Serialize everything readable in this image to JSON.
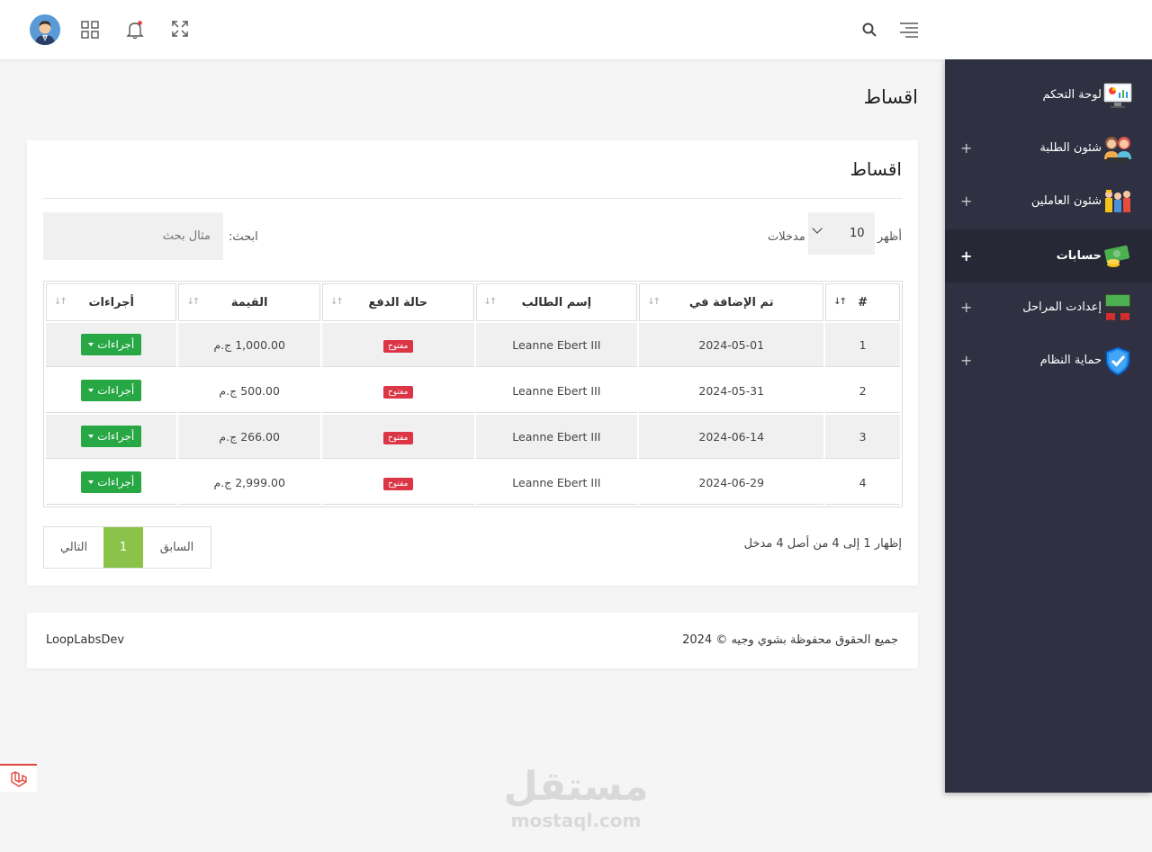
{
  "header": {
    "icons": [
      "menu-icon",
      "search-icon",
      "fullscreen-icon",
      "notification-bell-icon",
      "apps-grid-icon",
      "user-avatar"
    ]
  },
  "sidebar": {
    "items": [
      {
        "label": "لوحة التحكم",
        "icon": "dashboard-icon",
        "expandable": false
      },
      {
        "label": "شئون الطلبة",
        "icon": "students-icon",
        "expandable": true
      },
      {
        "label": "شئون العاملين",
        "icon": "staff-icon",
        "expandable": true
      },
      {
        "label": "حسابات",
        "icon": "money-icon",
        "expandable": true,
        "active": true
      },
      {
        "label": "إعدادت المراحل",
        "icon": "classroom-icon",
        "expandable": true
      },
      {
        "label": "حماية النظام",
        "icon": "shield-icon",
        "expandable": true
      }
    ],
    "plus": "+"
  },
  "page": {
    "title": "اقساط"
  },
  "card": {
    "title": "اقساط",
    "show_label": "أظهر",
    "entries_value": "10",
    "entries_label": "مدخلات",
    "search_label": "ابحث:",
    "search_placeholder": "مثال بحث"
  },
  "table": {
    "columns": [
      "#",
      "تم الإضافة في",
      "إسم الطالب",
      "حالة الدفع",
      "القيمة",
      "أجراءات"
    ],
    "rows": [
      {
        "num": "1",
        "date": "2024-05-01",
        "student": "Leanne Ebert III",
        "status": "مفتوح",
        "amount": "1,000.00 ج.م",
        "action": "أجراءات"
      },
      {
        "num": "2",
        "date": "2024-05-31",
        "student": "Leanne Ebert III",
        "status": "مفتوح",
        "amount": "500.00 ج.م",
        "action": "أجراءات"
      },
      {
        "num": "3",
        "date": "2024-06-14",
        "student": "Leanne Ebert III",
        "status": "مفتوح",
        "amount": "266.00 ج.م",
        "action": "أجراءات"
      },
      {
        "num": "4",
        "date": "2024-06-29",
        "student": "Leanne Ebert III",
        "status": "مفتوح",
        "amount": "2,999.00 ج.م",
        "action": "أجراءات"
      }
    ]
  },
  "pagination": {
    "info": "إظهار 1 إلى 4 من أصل 4 مدخل",
    "prev": "السابق",
    "current": "1",
    "next": "التالي"
  },
  "footer": {
    "copyright": "جميع الحقوق محفوظة بشوي وجيه © 2024",
    "brand": "LoopLabsDev"
  },
  "watermark": {
    "arabic": "مستقل",
    "latin": "mostaql.com"
  },
  "colors": {
    "sidebar_bg": "#2f3142",
    "success": "#28a745",
    "danger": "#dc3545",
    "pager_active": "#8bc34a"
  }
}
